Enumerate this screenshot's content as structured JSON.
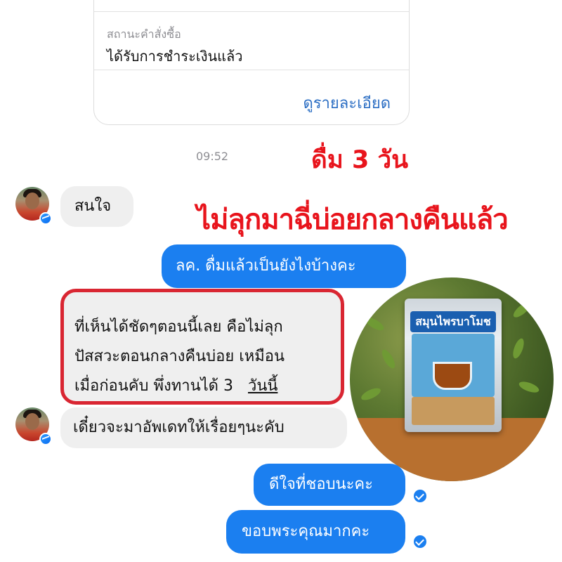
{
  "order_card": {
    "status_label": "สถานะคำสั่งซื้อ",
    "status_value": "ได้รับการชำระเงินแล้ว",
    "details_link": "ดูรายละเอียด"
  },
  "timestamp": "09:52",
  "promo": {
    "headline_1": "ดื่ม 3 วัน",
    "headline_2": "ไม่ลุกมาฉี่บ่อยกลางคืนแล้ว",
    "color": "#e8141c"
  },
  "messages": [
    {
      "sender": "customer",
      "text": "สนใจ"
    },
    {
      "sender": "shop",
      "text": "ลค. ดื่มแล้วเป็นยังไงบ้างคะ"
    },
    {
      "sender": "customer",
      "lines": [
        "ที่เห็นได้ชัดๆตอนนี้เลย คือไม่ลุก",
        "ปัสสวะตอนกลางคืนบ่อย เหมือน",
        "เมื่อก่อนคับ พึ่งทานได้ 3 ",
        "วันนี้"
      ],
      "highlighted": true
    },
    {
      "sender": "customer",
      "text": "เดี๋ยวจะมาอัพเดทให้เรื่อยๆนะคับ"
    },
    {
      "sender": "shop",
      "text": "ดีใจที่ชอบนะคะ"
    },
    {
      "sender": "shop",
      "text": "ขอบพระคุณมากคะ"
    }
  ],
  "product": {
    "pouch_title": "สมุนไพรบาโมช"
  },
  "colors": {
    "outgoing_bubble": "#1b7ff0",
    "incoming_bubble": "#efefef",
    "highlight_border": "#d92632",
    "link": "#2d6fc4"
  },
  "icons": [
    "messenger-badge-icon",
    "read-receipt-check-icon"
  ]
}
